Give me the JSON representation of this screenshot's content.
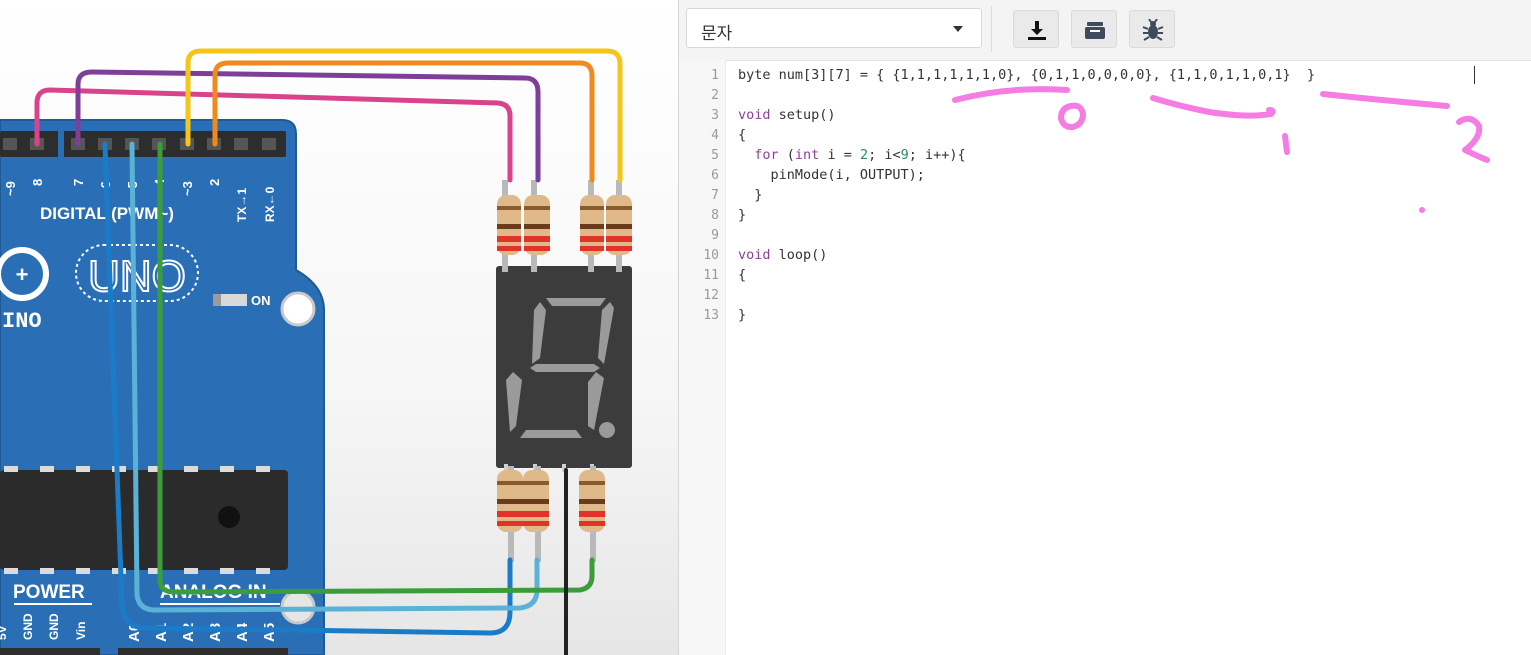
{
  "circuit": {
    "digital_label": "DIGITAL (PWM~)",
    "board_logo": "UNO",
    "board_name_fragment": "INO",
    "on_label": "ON",
    "power_label": "POWER",
    "analog_label": "ANALOG IN",
    "top_pin_labels": [
      "~9",
      "8",
      "7",
      "~6",
      "~5",
      "4",
      "~3",
      "2",
      "TX→1",
      "RX←0"
    ],
    "power_pin_labels": [
      "5V",
      "GND",
      "GND",
      "Vin"
    ],
    "analog_pin_labels": [
      "A0",
      "A1",
      "A2",
      "A3",
      "A4",
      "A5"
    ],
    "colors": {
      "board": "#2a6fb5",
      "wire_pink": "#d9438b",
      "wire_purple": "#7d3f98",
      "wire_orange": "#f08a1c",
      "wire_yellow": "#f5c518",
      "wire_blue": "#1a7cc9",
      "wire_lightblue": "#5ab3d6",
      "wire_green": "#3a9c3a",
      "display_body": "#3c3c3c",
      "segment_off": "#9a9a9a"
    }
  },
  "editor": {
    "mode_select_value": "문자",
    "toolbar_icons": [
      "download-icon",
      "library-icon",
      "debug-bug-icon"
    ],
    "line_numbers": [
      "1",
      "2",
      "3",
      "4",
      "5",
      "6",
      "7",
      "8",
      "9",
      "10",
      "11",
      "12",
      "13"
    ],
    "code": {
      "l1": "byte num[3][7] = { {1,1,1,1,1,1,0}, {0,1,1,0,0,0,0}, {1,1,0,1,1,0,1}  }",
      "l3_kw": "void",
      "l3_rest": " setup()",
      "l4": "{",
      "l5_pre": "  ",
      "l5_for": "for",
      "l5_a": " (",
      "l5_int": "int",
      "l5_b": " i = ",
      "l5_n2": "2",
      "l5_c": "; i<",
      "l5_n9": "9",
      "l5_d": "; i++){",
      "l6": "    pinMode(i, OUTPUT);",
      "l7": "  }",
      "l8": "}",
      "l10_kw": "void",
      "l10_rest": " loop()",
      "l11": "{",
      "l13": "}"
    },
    "annotation_color": "#f47ce3",
    "annotations": [
      "0",
      "1",
      "2"
    ]
  }
}
